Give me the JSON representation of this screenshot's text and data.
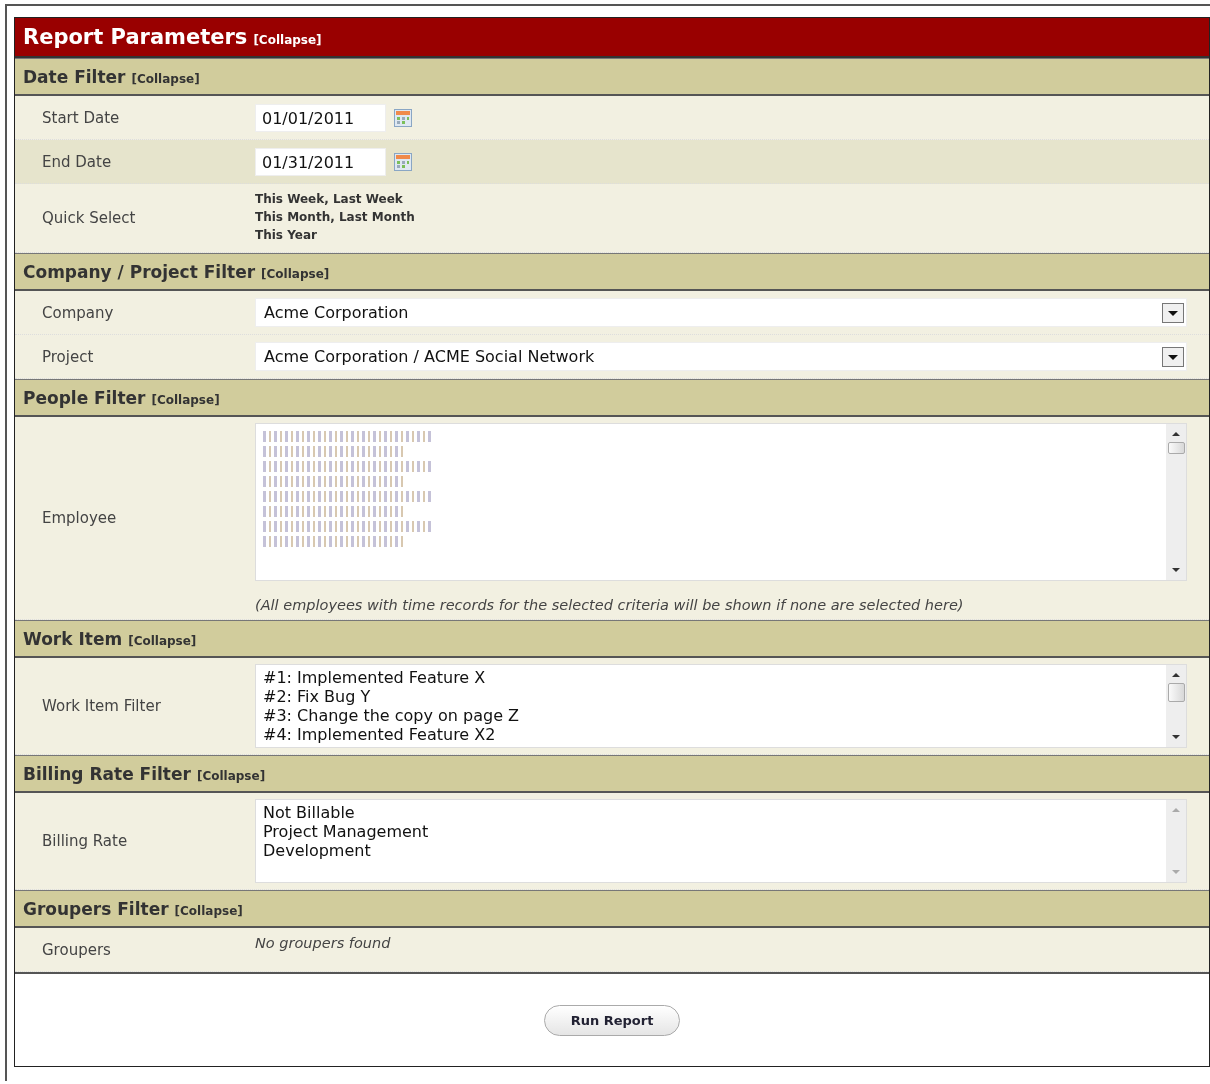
{
  "panel": {
    "title": "Report Parameters",
    "collapse": "[Collapse]"
  },
  "sections": [
    {
      "title": "Date Filter",
      "collapse": "[Collapse]",
      "rows": [
        {
          "kind": "date",
          "label": "Start Date",
          "value": "01/01/2011",
          "highlighted": false
        },
        {
          "kind": "date",
          "label": "End Date",
          "value": "01/31/2011",
          "highlighted": true
        },
        {
          "kind": "links",
          "label": "Quick Select",
          "lines": [
            "This Week, Last Week",
            "This Month, Last Month",
            "This Year"
          ],
          "highlighted": false
        }
      ]
    },
    {
      "title": "Company / Project Filter",
      "collapse": "[Collapse]",
      "rows": [
        {
          "kind": "select",
          "label": "Company",
          "value": "Acme Corporation",
          "highlighted": false
        },
        {
          "kind": "select",
          "label": "Project",
          "value": "Acme Corporation / ACME Social Network",
          "highlighted": false
        }
      ]
    },
    {
      "title": "People Filter",
      "collapse": "[Collapse]",
      "rows": [
        {
          "kind": "listbox",
          "label": "Employee",
          "thumb": true,
          "items": [
            {
              "kind": "obscured"
            },
            {
              "kind": "obscured"
            },
            {
              "kind": "obscured"
            },
            {
              "kind": "obscured"
            },
            {
              "kind": "obscured"
            },
            {
              "kind": "obscured"
            },
            {
              "kind": "obscured"
            },
            {
              "kind": "obscured"
            }
          ],
          "note": "(All employees with time records for the selected criteria will be shown if none are selected here)",
          "highlighted": false
        }
      ]
    },
    {
      "title": "Work Item",
      "collapse": "[Collapse]",
      "rows": [
        {
          "kind": "listbox",
          "label": "Work Item Filter",
          "thumb": true,
          "items": [
            {
              "kind": "text",
              "text": "#1: Implemented Feature X"
            },
            {
              "kind": "text",
              "text": "#2: Fix Bug Y"
            },
            {
              "kind": "text",
              "text": "#3: Change the copy on page Z"
            },
            {
              "kind": "text",
              "text": "#4: Implemented Feature X2"
            }
          ],
          "highlighted": false
        }
      ]
    },
    {
      "title": "Billing Rate Filter",
      "collapse": "[Collapse]",
      "rows": [
        {
          "kind": "listbox",
          "label": "Billing Rate",
          "thumb": false,
          "items": [
            {
              "kind": "text",
              "text": "Not Billable"
            },
            {
              "kind": "text",
              "text": "Project Management"
            },
            {
              "kind": "text",
              "text": "Development"
            }
          ],
          "highlighted": false
        }
      ]
    },
    {
      "title": "Groupers Filter",
      "collapse": "[Collapse]",
      "rows": [
        {
          "kind": "empty",
          "label": "Groupers",
          "message": "No groupers found",
          "highlighted": false
        }
      ]
    }
  ],
  "run_button": "Run Report"
}
